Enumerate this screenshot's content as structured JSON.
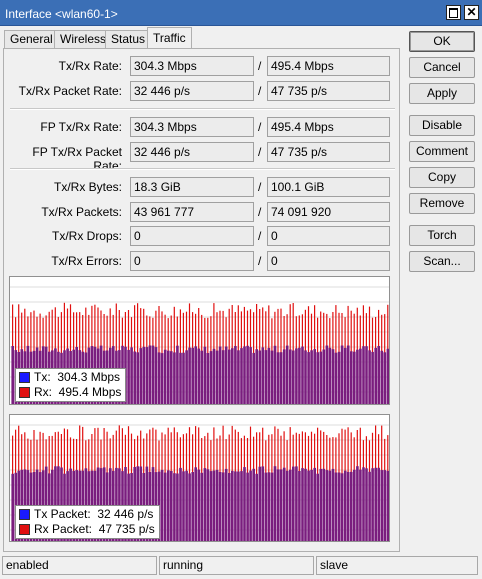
{
  "window": {
    "title": "Interface <wlan60-1>",
    "close_glyph": "✕"
  },
  "tabs": [
    {
      "label": "General"
    },
    {
      "label": "Wireless"
    },
    {
      "label": "Status"
    },
    {
      "label": "Traffic"
    }
  ],
  "rows": [
    {
      "label": "Tx/Rx Rate:",
      "tx": "304.3 Mbps",
      "rx": "495.4 Mbps"
    },
    {
      "label": "Tx/Rx Packet Rate:",
      "tx": "32 446 p/s",
      "rx": "47 735 p/s"
    },
    {
      "label": "FP Tx/Rx Rate:",
      "tx": "304.3 Mbps",
      "rx": "495.4 Mbps"
    },
    {
      "label": "FP Tx/Rx Packet Rate:",
      "tx": "32 446 p/s",
      "rx": "47 735 p/s"
    },
    {
      "label": "Tx/Rx Bytes:",
      "tx": "18.3 GiB",
      "rx": "100.1 GiB"
    },
    {
      "label": "Tx/Rx Packets:",
      "tx": "43 961 777",
      "rx": "74 091 920"
    },
    {
      "label": "Tx/Rx Drops:",
      "tx": "0",
      "rx": "0"
    },
    {
      "label": "Tx/Rx Errors:",
      "tx": "0",
      "rx": "0"
    }
  ],
  "slash": "/",
  "graphs": {
    "traffic": {
      "tx_label": "Tx:",
      "tx_value": "304.3 Mbps",
      "rx_label": "Rx:",
      "rx_value": "495.4 Mbps"
    },
    "packets": {
      "tx_label": "Tx Packet:",
      "tx_value": "32 446 p/s",
      "rx_label": "Rx Packet:",
      "rx_value": "47 735 p/s"
    }
  },
  "colors": {
    "tx": "#1a1aff",
    "rx": "#e01010",
    "graph_bar": "#7a1d7e"
  },
  "buttons": [
    "OK",
    "Cancel",
    "Apply",
    "Disable",
    "Comment",
    "Copy",
    "Remove",
    "Torch",
    "Scan..."
  ],
  "status": {
    "enabled": "enabled",
    "running": "running",
    "slave": "slave"
  }
}
